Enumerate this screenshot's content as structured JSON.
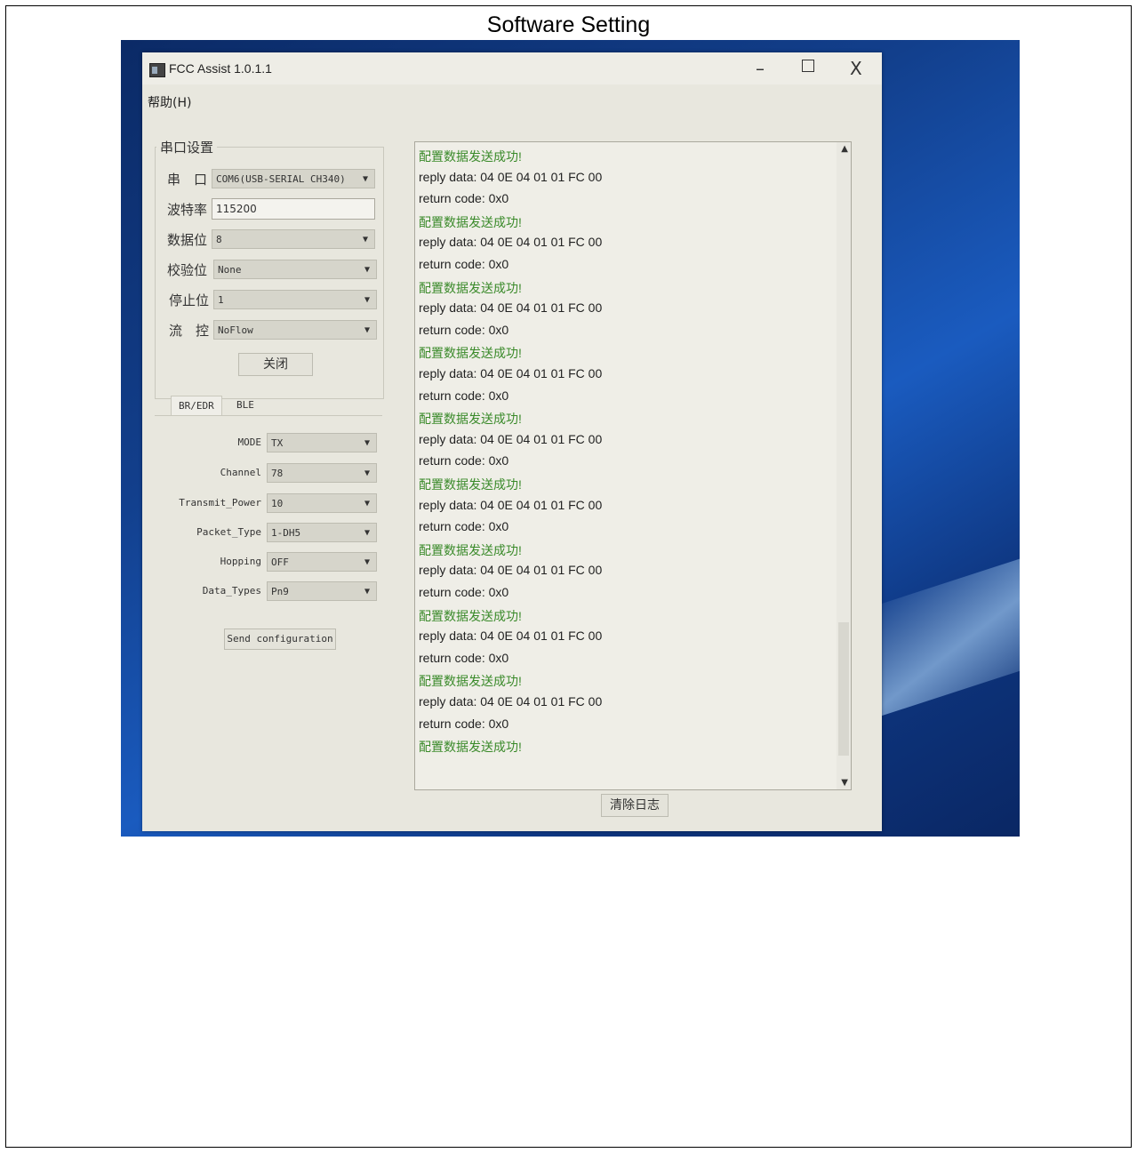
{
  "caption": "Software Setting",
  "window": {
    "title": "FCC Assist 1.0.1.1",
    "minimize": "–",
    "close": "X",
    "menu": "帮助(H)"
  },
  "serial": {
    "group_title": "串口设置",
    "port_label": "串　口",
    "port_value": "COM6(USB-SERIAL CH340)",
    "baud_label": "波特率",
    "baud_value": "115200",
    "data_bits_label": "数据位",
    "data_bits_value": "8",
    "parity_label": "校验位",
    "parity_value": "None",
    "stop_bits_label": "停止位",
    "stop_bits_value": "1",
    "flow_label": "流　控",
    "flow_value": "NoFlow",
    "close_button": "关闭"
  },
  "tabs": [
    {
      "label": "BR/EDR",
      "active": true
    },
    {
      "label": "BLE",
      "active": false
    }
  ],
  "config": {
    "mode_label": "MODE",
    "mode_value": "TX",
    "channel_label": "Channel",
    "channel_value": "78",
    "power_label": "Transmit_Power",
    "power_value": "10",
    "packet_label": "Packet_Type",
    "packet_value": "1-DH5",
    "hopping_label": "Hopping",
    "hopping_value": "OFF",
    "data_label": "Data_Types",
    "data_value": "Pn9",
    "send_button": "Send configuration"
  },
  "log": {
    "lines": [
      "配置数据发送成功!",
      "reply data: 04 0E 04 01 01 FC 00",
      "return code: 0x0",
      "配置数据发送成功!",
      "reply data: 04 0E 04 01 01 FC 00",
      "return code: 0x0",
      "配置数据发送成功!",
      "reply data: 04 0E 04 01 01 FC 00",
      "return code: 0x0",
      "配置数据发送成功!",
      "reply data: 04 0E 04 01 01 FC 00",
      "return code: 0x0",
      "配置数据发送成功!",
      "reply data: 04 0E 04 01 01 FC 00",
      "return code: 0x0",
      "配置数据发送成功!",
      "reply data: 04 0E 04 01 01 FC 00",
      "return code: 0x0",
      "配置数据发送成功!",
      "reply data: 04 0E 04 01 01 FC 00",
      "return code: 0x0",
      "配置数据发送成功!",
      "reply data: 04 0E 04 01 01 FC 00",
      "return code: 0x0",
      "配置数据发送成功!",
      "reply data: 04 0E 04 01 01 FC 00",
      "return code: 0x0",
      "配置数据发送成功!"
    ],
    "clear_button": "清除日志"
  },
  "colors": {
    "success_text": "#3a8a2a",
    "desktop": "#123f8c"
  },
  "icons": {
    "scroll_up": "▲",
    "scroll_down": "▼",
    "dropdown": "▼"
  }
}
